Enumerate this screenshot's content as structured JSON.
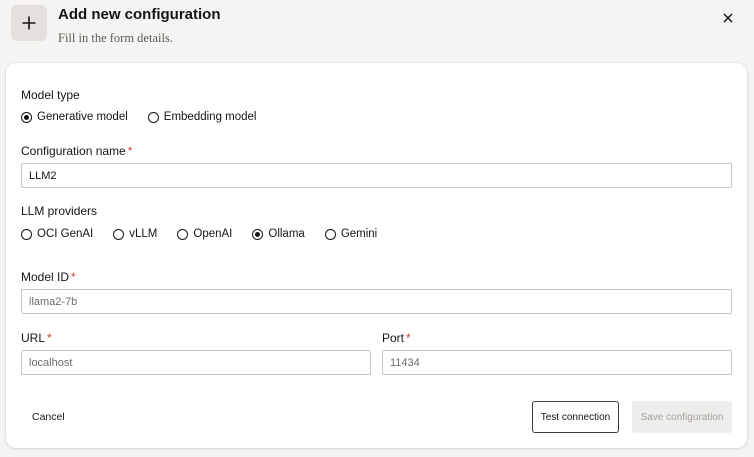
{
  "header": {
    "title": "Add new configuration",
    "subtitle": "Fill in the form details."
  },
  "form": {
    "model_type": {
      "label": "Model type",
      "options": [
        "Generative model",
        "Embedding model"
      ],
      "selected": "Generative model"
    },
    "configuration_name": {
      "label": "Configuration name",
      "required_mark": "*",
      "value": "LLM2"
    },
    "llm_providers": {
      "label": "LLM providers",
      "options": [
        "OCI GenAI",
        "vLLM",
        "OpenAI",
        "Ollama",
        "Gemini"
      ],
      "selected": "Ollama"
    },
    "model_id": {
      "label": "Model ID",
      "required_mark": "*",
      "placeholder": "llama2-7b"
    },
    "url": {
      "label": "URL",
      "required_mark": "*",
      "placeholder": "localhost"
    },
    "port": {
      "label": "Port",
      "required_mark": "*",
      "placeholder": "11434"
    }
  },
  "footer": {
    "cancel_label": "Cancel",
    "test_label": "Test connection",
    "save_label": "Save configuration"
  },
  "colors": {
    "required": "#c74634",
    "background": "#f5f4f2",
    "card": "#ffffff"
  },
  "icons": {
    "add": "plus-icon",
    "close": "close-icon"
  }
}
